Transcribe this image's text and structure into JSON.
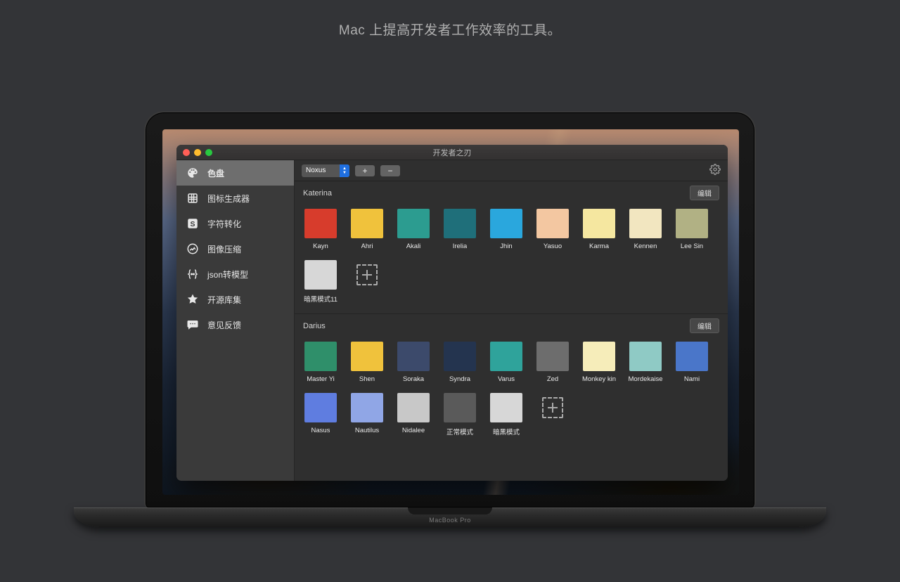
{
  "tagline": "Mac 上提高开发者工作效率的工具。",
  "laptop_label": "MacBook Pro",
  "window_title": "开发者之刃",
  "sidebar": {
    "items": [
      {
        "label": "色盘",
        "icon": "palette",
        "selected": true
      },
      {
        "label": "图标生成器",
        "icon": "grid",
        "selected": false
      },
      {
        "label": "字符转化",
        "icon": "letter-s",
        "selected": false
      },
      {
        "label": "图像压缩",
        "icon": "image-circle",
        "selected": false
      },
      {
        "label": "json转模型",
        "icon": "braces",
        "selected": false
      },
      {
        "label": "开源库集",
        "icon": "star",
        "selected": false
      },
      {
        "label": "意见反馈",
        "icon": "chat",
        "selected": false
      }
    ]
  },
  "toolbar": {
    "select_value": "Noxus",
    "plus_label": "+",
    "minus_label": "−",
    "gear_icon": "gear"
  },
  "edit_label": "编辑",
  "palettes": [
    {
      "name": "Katerina",
      "swatches": [
        {
          "label": "Kayn",
          "color": "#d73c2c"
        },
        {
          "label": "Ahri",
          "color": "#f0c23c"
        },
        {
          "label": "Akali",
          "color": "#2c9c90"
        },
        {
          "label": "Irelia",
          "color": "#1f6f7a"
        },
        {
          "label": "Jhin",
          "color": "#2aa7dd"
        },
        {
          "label": "Yasuo",
          "color": "#f3c7a1"
        },
        {
          "label": "Karma",
          "color": "#f5e7a0"
        },
        {
          "label": "Kennen",
          "color": "#f2e6c0"
        },
        {
          "label": "Lee Sin",
          "color": "#b1b184"
        },
        {
          "label": "暗黑模式11",
          "color": "#d7d7d7"
        }
      ],
      "has_add": true
    },
    {
      "name": "Darius",
      "swatches": [
        {
          "label": "Master Yi",
          "color": "#2f8f6a"
        },
        {
          "label": "Shen",
          "color": "#f0c23c"
        },
        {
          "label": "Soraka",
          "color": "#3c4a6b"
        },
        {
          "label": "Syndra",
          "color": "#24344f"
        },
        {
          "label": "Varus",
          "color": "#2fa39b"
        },
        {
          "label": "Zed",
          "color": "#6d6d6d"
        },
        {
          "label": "Monkey kin",
          "color": "#f6edba"
        },
        {
          "label": "Mordekaise",
          "color": "#8fcac5"
        },
        {
          "label": "Nami",
          "color": "#4a76c9"
        },
        {
          "label": "Nasus",
          "color": "#5f7de0"
        },
        {
          "label": "Nautilus",
          "color": "#90a6e6"
        },
        {
          "label": "Nidalee",
          "color": "#c8c8c8"
        },
        {
          "label": "正常模式",
          "color": "#5a5a5a"
        },
        {
          "label": "暗黑模式",
          "color": "#d7d7d7"
        }
      ],
      "has_add": true
    }
  ]
}
